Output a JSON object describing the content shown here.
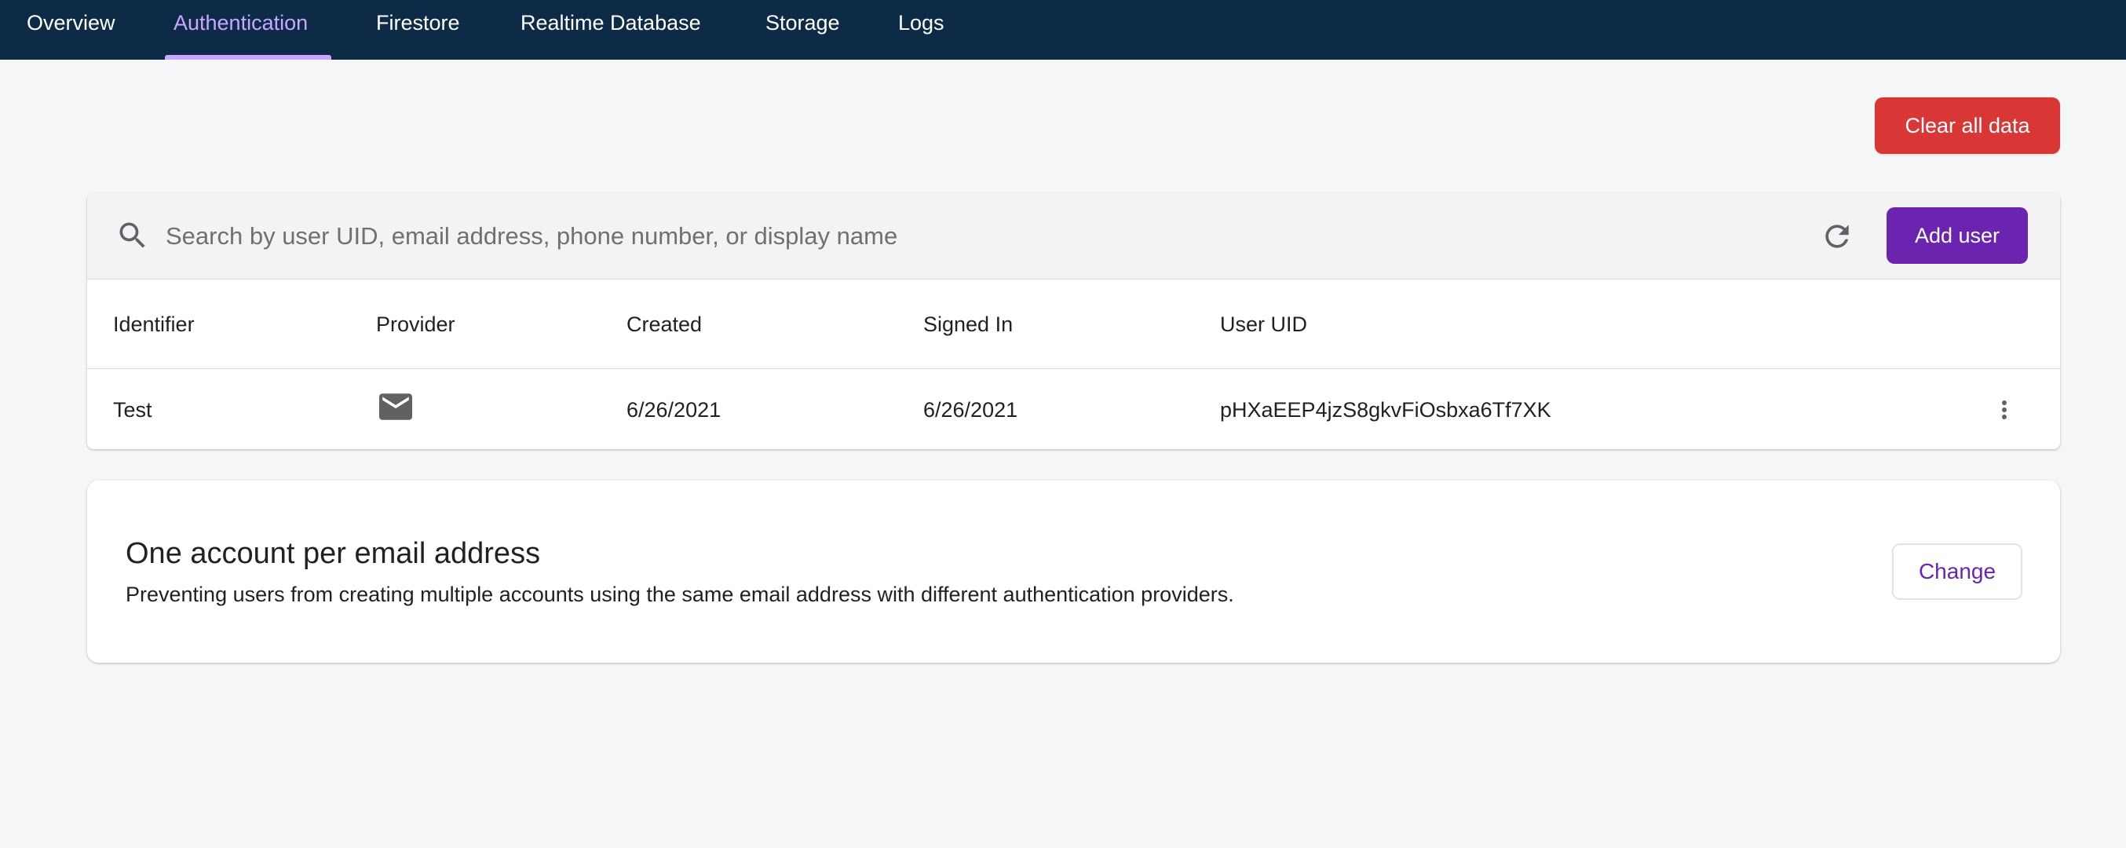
{
  "nav": {
    "tabs": [
      {
        "label": "Overview",
        "active": false
      },
      {
        "label": "Authentication",
        "active": true
      },
      {
        "label": "Firestore",
        "active": false
      },
      {
        "label": "Realtime Database",
        "active": false
      },
      {
        "label": "Storage",
        "active": false
      },
      {
        "label": "Logs",
        "active": false
      }
    ]
  },
  "actions": {
    "clear_all_label": "Clear all data"
  },
  "users": {
    "search_placeholder": "Search by user UID, email address, phone number, or display name",
    "add_user_label": "Add user",
    "columns": [
      "Identifier",
      "Provider",
      "Created",
      "Signed In",
      "User UID"
    ],
    "rows": [
      {
        "identifier": "Test",
        "provider_icon": "mail-icon",
        "created": "6/26/2021",
        "signed_in": "6/26/2021",
        "uid": "pHXaEEP4jzS8gkvFiOsbxa6Tf7XK"
      }
    ]
  },
  "policy": {
    "title": "One account per email address",
    "description": "Preventing users from creating multiple accounts using the same email address with different authentication providers.",
    "change_label": "Change"
  },
  "colors": {
    "nav_background": "#0d2b47",
    "active_tab": "#c9a6ff",
    "danger": "#d93636",
    "primary": "#6a24b0"
  }
}
